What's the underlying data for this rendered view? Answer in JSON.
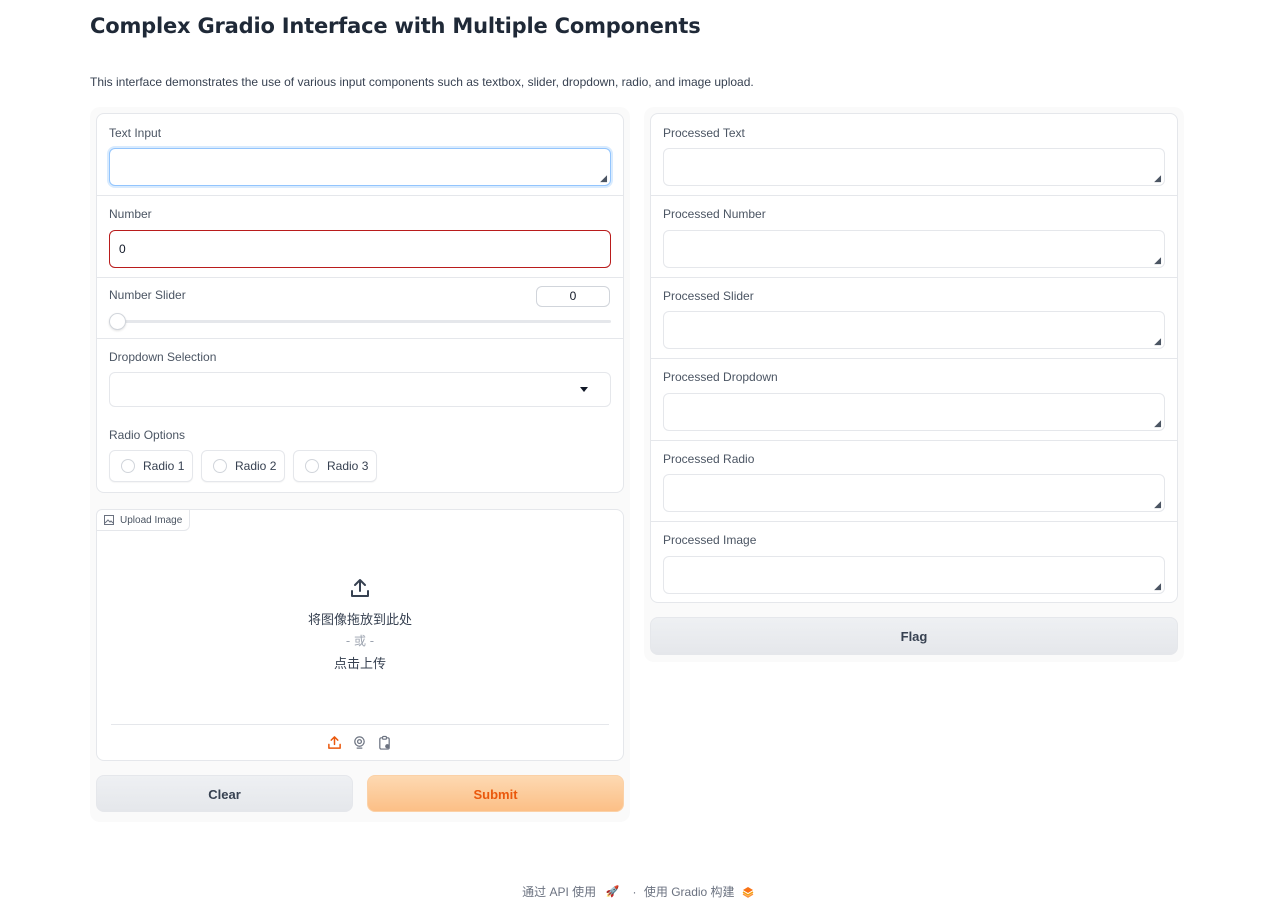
{
  "title": "Complex Gradio Interface with Multiple Components",
  "description": "This interface demonstrates the use of various input components such as textbox, slider, dropdown, radio, and image upload.",
  "inputs": {
    "text_input": {
      "label": "Text Input",
      "value": ""
    },
    "number": {
      "label": "Number",
      "value": "0"
    },
    "slider": {
      "label": "Number Slider",
      "value": "0",
      "fraction": 0
    },
    "dropdown": {
      "label": "Dropdown Selection",
      "value": ""
    },
    "radio": {
      "label": "Radio Options",
      "options": [
        "Radio 1",
        "Radio 2",
        "Radio 3"
      ]
    },
    "image": {
      "label": "Upload Image",
      "drop_text": "将图像拖放到此处",
      "or_text": "- 或 -",
      "click_text": "点击上传"
    }
  },
  "buttons": {
    "clear": "Clear",
    "submit": "Submit",
    "flag": "Flag"
  },
  "outputs": [
    {
      "label": "Processed Text"
    },
    {
      "label": "Processed Number"
    },
    {
      "label": "Processed Slider"
    },
    {
      "label": "Processed Dropdown"
    },
    {
      "label": "Processed Radio"
    },
    {
      "label": "Processed Image"
    }
  ],
  "footer": {
    "api": "通过 API 使用",
    "separator": "·",
    "built": "使用 Gradio 构建"
  },
  "colors": {
    "primary_accent": "#ea580c",
    "error_border": "#b91c1c",
    "focus_border": "#93c5fd"
  }
}
